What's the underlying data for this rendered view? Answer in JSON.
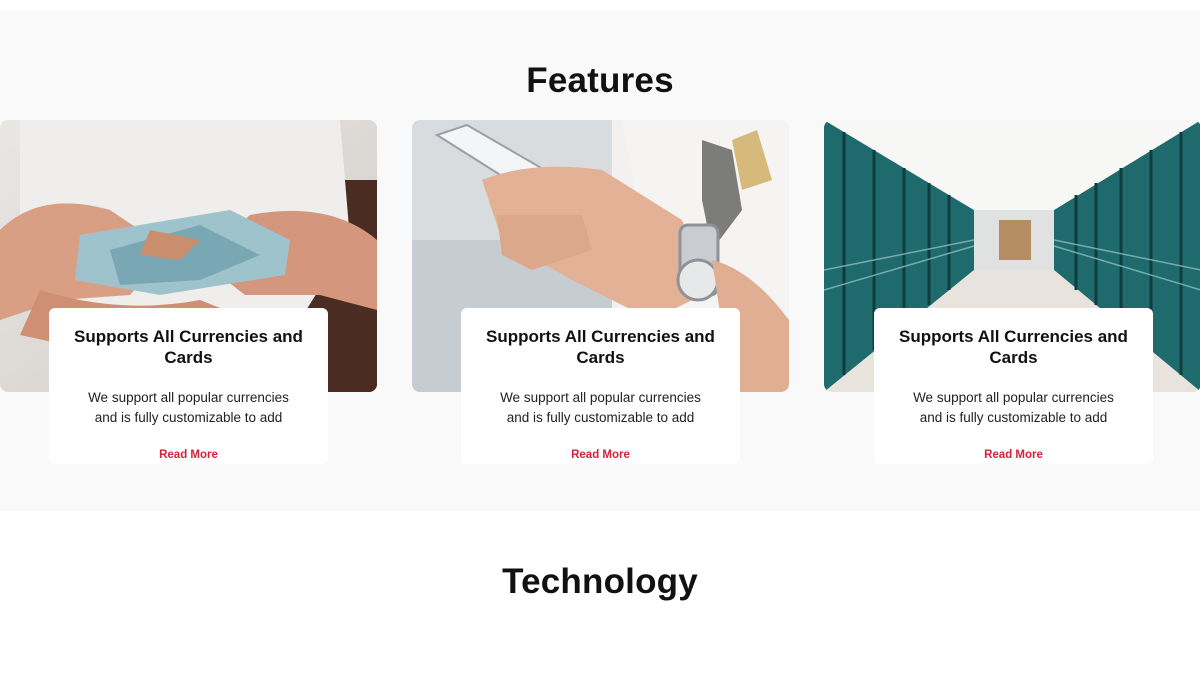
{
  "features": {
    "title": "Features",
    "cards": [
      {
        "title": "Supports All Currencies and Cards",
        "description": "We support all popular currencies and is fully customizable to add",
        "link": "Read More",
        "image": "hands-holding-euro-banknotes"
      },
      {
        "title": "Supports All Currencies and Cards",
        "description": "We support all popular currencies and is fully customizable to add",
        "link": "Read More",
        "image": "hands-holding-smartphone"
      },
      {
        "title": "Supports All Currencies and Cards",
        "description": "We support all popular currencies and is fully customizable to add",
        "link": "Read More",
        "image": "glass-corridor-building"
      }
    ]
  },
  "technology": {
    "title": "Technology"
  },
  "colors": {
    "section_bg": "#f9f9f9",
    "accent_link": "#d6213a",
    "card_bg": "#ffffff"
  }
}
